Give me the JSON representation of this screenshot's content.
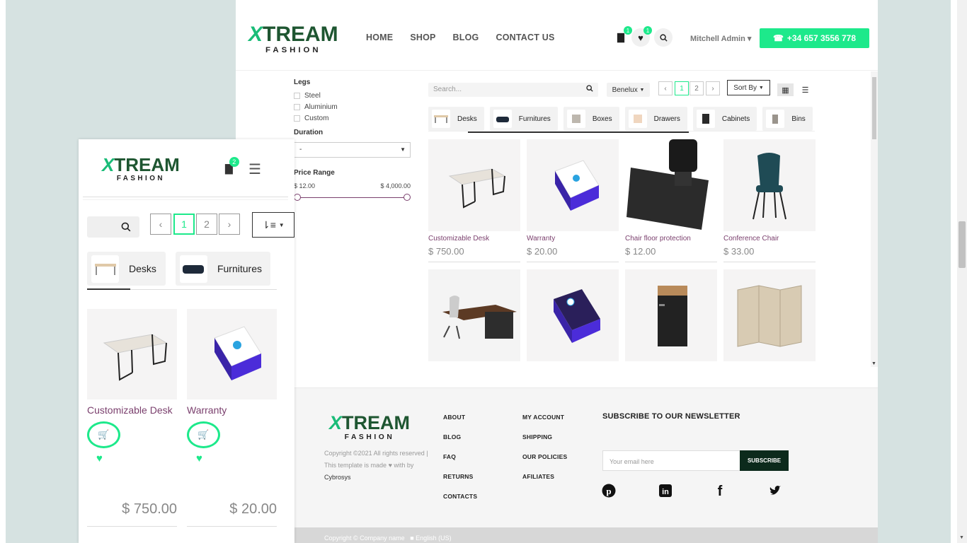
{
  "header": {
    "logo_main": "TREAM",
    "logo_x": "X",
    "logo_sub": "FASHION",
    "nav": [
      "HOME",
      "SHOP",
      "BLOG",
      "CONTACT US"
    ],
    "cart_count": "1",
    "wishlist_count": "1",
    "user": "Mitchell Admin",
    "phone": "+34 657 3556 778"
  },
  "filters": {
    "legs_title": "Legs",
    "legs_options": [
      "Steel",
      "Aluminium",
      "Custom"
    ],
    "duration_title": "Duration",
    "duration_value": "-",
    "price_title": "Price Range",
    "price_min": "$ 12.00",
    "price_max": "$ 4,000.00"
  },
  "toolbar": {
    "search_placeholder": "Search...",
    "pricelist": "Benelux",
    "pages": [
      "1",
      "2"
    ],
    "sort_label": "Sort By"
  },
  "categories": [
    "Desks",
    "Furnitures",
    "Boxes",
    "Drawers",
    "Cabinets",
    "Bins"
  ],
  "products": [
    {
      "name": "Customizable Desk",
      "price": "$ 750.00"
    },
    {
      "name": "Warranty",
      "price": "$ 20.00"
    },
    {
      "name": "Chair floor protection",
      "price": "$ 12.00"
    },
    {
      "name": "Conference Chair",
      "price": "$ 33.00"
    },
    {
      "name": "",
      "price": ""
    },
    {
      "name": "",
      "price": ""
    },
    {
      "name": "",
      "price": ""
    },
    {
      "name": "",
      "price": ""
    }
  ],
  "footer": {
    "copyright": "Copyright ©2021 All rights reserved | This template is made",
    "with_by": "with by",
    "company": "Cybrosys",
    "col1": [
      "ABOUT",
      "BLOG",
      "FAQ",
      "RETURNS",
      "CONTACTS"
    ],
    "col2": [
      "MY ACCOUNT",
      "SHIPPING",
      "OUR POLICIES",
      "AFILIATES"
    ],
    "newsletter_title": "SUBSCRIBE TO OUR NEWSLETTER",
    "email_placeholder": "Your email here",
    "subscribe": "SUBSCRIBE",
    "bottom_text": "Copyright © Company name",
    "language": "English (US)"
  },
  "mobile": {
    "cart_count": "2",
    "pages": [
      "1",
      "2"
    ],
    "categories": [
      "Desks",
      "Furnitures"
    ],
    "products": [
      {
        "name": "Customizable Desk",
        "price": "$ 750.00"
      },
      {
        "name": "Warranty",
        "price": "$ 20.00"
      }
    ]
  },
  "colors": {
    "accent": "#1de98b",
    "brand": "#1e5631",
    "product_name": "#7a3f6d"
  }
}
